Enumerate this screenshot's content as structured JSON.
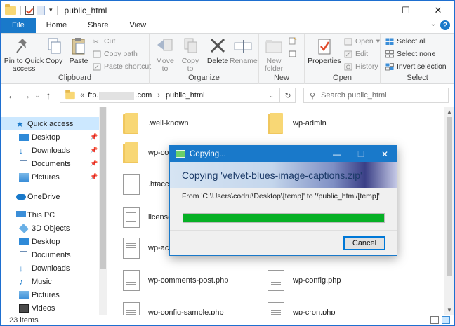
{
  "window": {
    "title": "public_html",
    "controls": {
      "minimize": "—",
      "maximize": "☐",
      "close": "✕"
    }
  },
  "tabs": {
    "file": "File",
    "home": "Home",
    "share": "Share",
    "view": "View",
    "help": "?"
  },
  "ribbon": {
    "clipboard": {
      "label": "Clipboard",
      "pin": "Pin to Quick access",
      "copy": "Copy",
      "paste": "Paste",
      "cut": "Cut",
      "copy_path": "Copy path",
      "paste_shortcut": "Paste shortcut"
    },
    "organize": {
      "label": "Organize",
      "move_to": "Move to",
      "copy_to": "Copy to",
      "delete": "Delete",
      "rename": "Rename"
    },
    "new": {
      "label": "New",
      "new_folder": "New folder"
    },
    "open": {
      "label": "Open",
      "properties": "Properties",
      "open": "Open",
      "edit": "Edit",
      "history": "History"
    },
    "select": {
      "label": "Select",
      "select_all": "Select all",
      "select_none": "Select none",
      "invert": "Invert selection"
    }
  },
  "address": {
    "prefix": "«",
    "host_start": "ftp.",
    "host_end": ".com",
    "sep": "›",
    "folder": "public_html",
    "search_placeholder": "Search public_html"
  },
  "nav": {
    "items": [
      {
        "label": "Quick access",
        "pinned": false
      },
      {
        "label": "Desktop",
        "pinned": true
      },
      {
        "label": "Downloads",
        "pinned": true
      },
      {
        "label": "Documents",
        "pinned": true
      },
      {
        "label": "Pictures",
        "pinned": true
      },
      {
        "label": "OneDrive",
        "pinned": false
      },
      {
        "label": "This PC",
        "pinned": false
      },
      {
        "label": "3D Objects",
        "pinned": false
      },
      {
        "label": "Desktop",
        "pinned": false
      },
      {
        "label": "Documents",
        "pinned": false
      },
      {
        "label": "Downloads",
        "pinned": false
      },
      {
        "label": "Music",
        "pinned": false
      },
      {
        "label": "Pictures",
        "pinned": false
      },
      {
        "label": "Videos",
        "pinned": false
      }
    ]
  },
  "files": {
    "left": [
      {
        "name": ".well-known",
        "type": "folder"
      },
      {
        "name": "wp-co",
        "type": "folder"
      },
      {
        "name": ".htacce",
        "type": "file"
      },
      {
        "name": "license",
        "type": "text"
      },
      {
        "name": "wp-ac",
        "type": "text"
      },
      {
        "name": "wp-comments-post.php",
        "type": "text"
      },
      {
        "name": "wp-config-sample.php",
        "type": "text"
      }
    ],
    "right": [
      {
        "name": "wp-admin",
        "type": "folder"
      },
      {
        "name": "",
        "type": "folder"
      },
      {
        "name": "",
        "type": "file"
      },
      {
        "name": "",
        "type": "text"
      },
      {
        "name": "",
        "type": "text"
      },
      {
        "name": "wp-config.php",
        "type": "text"
      },
      {
        "name": "wp-cron.php",
        "type": "text"
      }
    ]
  },
  "status": {
    "count": "23 items"
  },
  "dialog": {
    "title": "Copying...",
    "heading": "Copying 'velvet-blues-image-captions.zip'",
    "from_text": "From 'C:\\Users\\codru\\Desktop\\[temp]' to '/public_html/[temp]'",
    "progress": 1.0,
    "cancel": "Cancel",
    "close": "✕",
    "minimize": "—",
    "maximize": "☐"
  },
  "colors": {
    "accent": "#1979ca",
    "progress": "#06b025",
    "folder": "#f8d775",
    "selection": "#cce8ff"
  }
}
